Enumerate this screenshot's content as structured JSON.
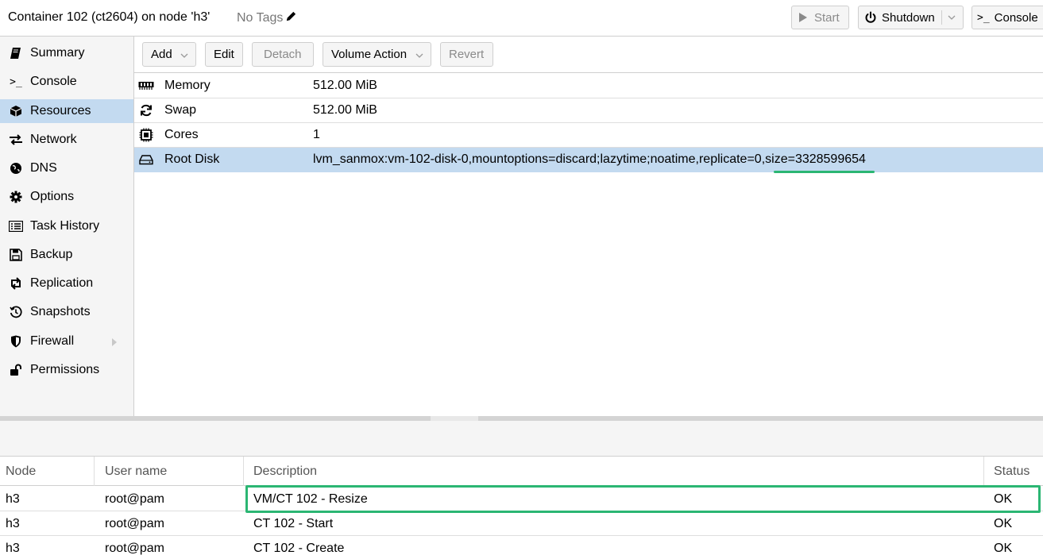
{
  "header": {
    "title": "Container 102 (ct2604) on node 'h3'",
    "tags_label": "No Tags",
    "start_label": "Start",
    "shutdown_label": "Shutdown",
    "console_label": "Console"
  },
  "sidebar": {
    "items": [
      {
        "label": "Summary",
        "icon": "book-icon"
      },
      {
        "label": "Console",
        "icon": "terminal-icon"
      },
      {
        "label": "Resources",
        "icon": "cube-icon",
        "active": true
      },
      {
        "label": "Network",
        "icon": "exchange-icon"
      },
      {
        "label": "DNS",
        "icon": "globe-icon"
      },
      {
        "label": "Options",
        "icon": "gear-icon"
      },
      {
        "label": "Task History",
        "icon": "list-icon"
      },
      {
        "label": "Backup",
        "icon": "floppy-icon"
      },
      {
        "label": "Replication",
        "icon": "retweet-icon"
      },
      {
        "label": "Snapshots",
        "icon": "history-icon"
      },
      {
        "label": "Firewall",
        "icon": "shield-icon"
      },
      {
        "label": "Permissions",
        "icon": "unlock-icon"
      }
    ]
  },
  "toolbar": {
    "add_label": "Add",
    "edit_label": "Edit",
    "detach_label": "Detach",
    "volume_action_label": "Volume Action",
    "revert_label": "Revert"
  },
  "resources": [
    {
      "key": "Memory",
      "value": "512.00 MiB",
      "icon": "memory-icon"
    },
    {
      "key": "Swap",
      "value": "512.00 MiB",
      "icon": "refresh-icon"
    },
    {
      "key": "Cores",
      "value": "1",
      "icon": "cpu-icon"
    },
    {
      "key": "Root Disk",
      "value": "lvm_sanmox:vm-102-disk-0,mountoptions=discard;lazytime;noatime,replicate=0,size=3328599654",
      "icon": "hdd-icon",
      "selected": true
    }
  ],
  "tasks": {
    "columns": {
      "node": "Node",
      "user": "User name",
      "description": "Description",
      "status": "Status"
    },
    "rows": [
      {
        "node": "h3",
        "user": "root@pam",
        "description": "VM/CT 102 - Resize",
        "status": "OK"
      },
      {
        "node": "h3",
        "user": "root@pam",
        "description": "CT 102 - Start",
        "status": "OK"
      },
      {
        "node": "h3",
        "user": "root@pam",
        "description": "CT 102 - Create",
        "status": "OK"
      }
    ]
  },
  "colors": {
    "selection": "#c3daf0",
    "highlight": "#2bb673",
    "sidebar_bg": "#f5f5f5"
  }
}
